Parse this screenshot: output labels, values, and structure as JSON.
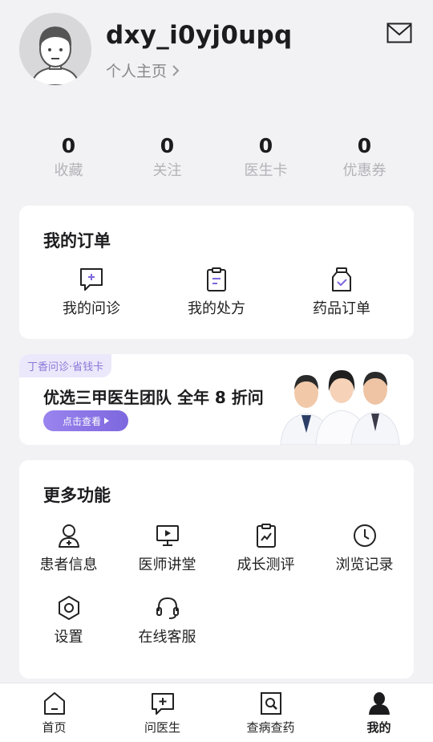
{
  "profile": {
    "username": "dxy_i0yj0upq",
    "homepage_label": "个人主页"
  },
  "stats": [
    {
      "value": "0",
      "label": "收藏"
    },
    {
      "value": "0",
      "label": "关注"
    },
    {
      "value": "0",
      "label": "医生卡"
    },
    {
      "value": "0",
      "label": "优惠券"
    }
  ],
  "orders": {
    "title": "我的订单",
    "items": [
      {
        "label": "我的问诊",
        "icon": "consultation-icon"
      },
      {
        "label": "我的处方",
        "icon": "prescription-icon"
      },
      {
        "label": "药品订单",
        "icon": "medicine-order-icon"
      }
    ]
  },
  "banner": {
    "tag": "丁香问诊·省钱卡",
    "title": "优选三甲医生团队 全年 8 折问",
    "button": "点击查看"
  },
  "more": {
    "title": "更多功能",
    "items": [
      {
        "label": "患者信息",
        "icon": "patient-info-icon"
      },
      {
        "label": "医师讲堂",
        "icon": "lecture-icon"
      },
      {
        "label": "成长测评",
        "icon": "growth-assessment-icon"
      },
      {
        "label": "浏览记录",
        "icon": "history-clock-icon"
      },
      {
        "label": "设置",
        "icon": "settings-hex-icon"
      },
      {
        "label": "在线客服",
        "icon": "headset-icon"
      }
    ]
  },
  "tabbar": [
    {
      "label": "首页",
      "icon": "home-icon",
      "active": false
    },
    {
      "label": "问医生",
      "icon": "ask-doctor-icon",
      "active": false
    },
    {
      "label": "查病查药",
      "icon": "search-document-icon",
      "active": false
    },
    {
      "label": "我的",
      "icon": "user-icon",
      "active": true
    }
  ],
  "colors": {
    "background": "#f2f2f5",
    "accent_purple": "#8a78d8",
    "text_primary": "#1c1c1e",
    "text_muted": "#b3b3b8"
  }
}
